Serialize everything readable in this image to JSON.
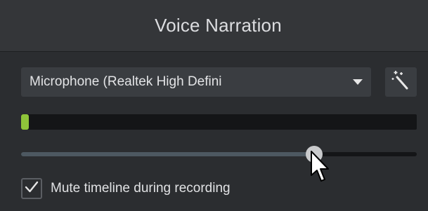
{
  "header": {
    "title": "Voice Narration"
  },
  "microphone": {
    "selected": "Microphone (Realtek High Defini",
    "dropdown_icon": "chevron-down-icon",
    "auto_button_icon": "magic-wand-icon"
  },
  "level_meter": {
    "level": 0.02,
    "fill_color": "#8fc53a"
  },
  "volume_slider": {
    "value": 0.74
  },
  "mute": {
    "label": "Mute timeline during recording",
    "checked": true
  },
  "cursor_icon": "mouse-pointer-icon"
}
